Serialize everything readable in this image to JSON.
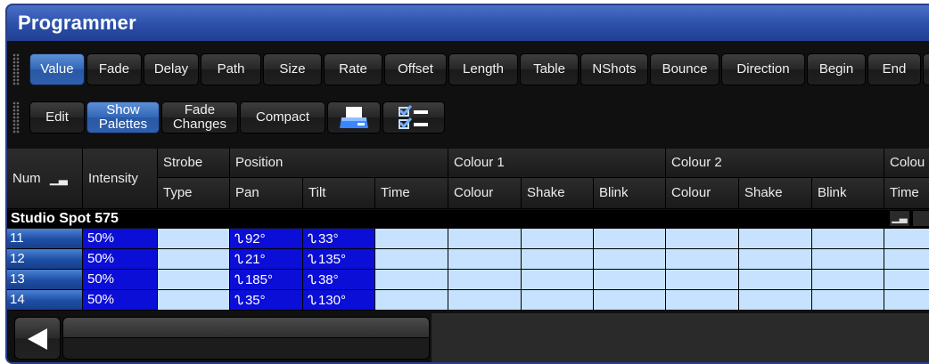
{
  "window": {
    "title": "Programmer"
  },
  "toolbar1": [
    {
      "label": "Value",
      "active": true
    },
    {
      "label": "Fade",
      "active": false
    },
    {
      "label": "Delay",
      "active": false
    },
    {
      "label": "Path",
      "active": false
    },
    {
      "label": "Size",
      "active": false
    },
    {
      "label": "Rate",
      "active": false
    },
    {
      "label": "Offset",
      "active": false
    },
    {
      "label": "Length",
      "active": false
    },
    {
      "label": "Table",
      "active": false
    },
    {
      "label": "NShots",
      "active": false
    },
    {
      "label": "Bounce",
      "active": false
    },
    {
      "label": "Direction",
      "active": false
    },
    {
      "label": "Begin",
      "active": false
    },
    {
      "label": "End",
      "active": false
    }
  ],
  "toolbar2": {
    "edit": "Edit",
    "show_palettes": [
      "Show",
      "Palettes"
    ],
    "fade_changes": [
      "Fade",
      "Changes"
    ],
    "compact": "Compact",
    "print_icon": "printer-icon",
    "checklist_icon": "checklist-icon"
  },
  "table": {
    "header_top": {
      "num": "Num",
      "intensity": "Intensity",
      "strobe": "Strobe",
      "position": "Position",
      "colour1": "Colour 1",
      "colour2": "Colour 2",
      "colour3": "Colou"
    },
    "header_bottom": {
      "strobe_type": "Type",
      "pan": "Pan",
      "tilt": "Tilt",
      "time": "Time",
      "c1_colour": "Colour",
      "c1_shake": "Shake",
      "c1_blink": "Blink",
      "c2_colour": "Colour",
      "c2_shake": "Shake",
      "c2_blink": "Blink",
      "c3_time": "Time"
    },
    "fixture_type": "Studio Spot 575",
    "rows": [
      {
        "num": "11",
        "intensity": "50%",
        "pan": "92°",
        "tilt": "33°"
      },
      {
        "num": "12",
        "intensity": "50%",
        "pan": "21°",
        "tilt": "135°"
      },
      {
        "num": "13",
        "intensity": "50%",
        "pan": "185°",
        "tilt": "38°"
      },
      {
        "num": "14",
        "intensity": "50%",
        "pan": "35°",
        "tilt": "130°"
      }
    ],
    "path_glyph": "ᔐ"
  },
  "colors": {
    "title_bar": "#2b4fa8",
    "active_button": "#3167b7",
    "value_cell": "#0b0ed6",
    "empty_cell": "#c6e2ff"
  }
}
